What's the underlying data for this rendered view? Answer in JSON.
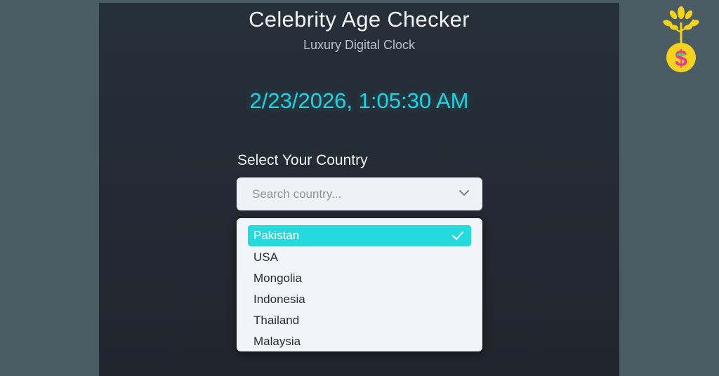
{
  "header": {
    "title": "Celebrity Age Checker",
    "subtitle": "Luxury Digital Clock"
  },
  "clock": {
    "datetime": "2/23/2026, 1:05:30 AM"
  },
  "country_select": {
    "label": "Select Your Country",
    "placeholder": "Search country...",
    "selected": "Pakistan",
    "options": [
      {
        "label": "Pakistan"
      },
      {
        "label": "USA"
      },
      {
        "label": "Mongolia"
      },
      {
        "label": "Indonesia"
      },
      {
        "label": "Thailand"
      },
      {
        "label": "Malaysia"
      }
    ]
  },
  "icons": {
    "dropdown": "chevron-down-icon",
    "selected": "checkmark-icon",
    "logo": "money-tree-icon"
  },
  "colors": {
    "accent": "#27cfe0",
    "selected_bg": "#25dadc",
    "page_bg": "#4b5b63",
    "panel_bg": "#232a33",
    "logo_yellow": "#f5d21c",
    "logo_dollar": "#e8369a"
  }
}
